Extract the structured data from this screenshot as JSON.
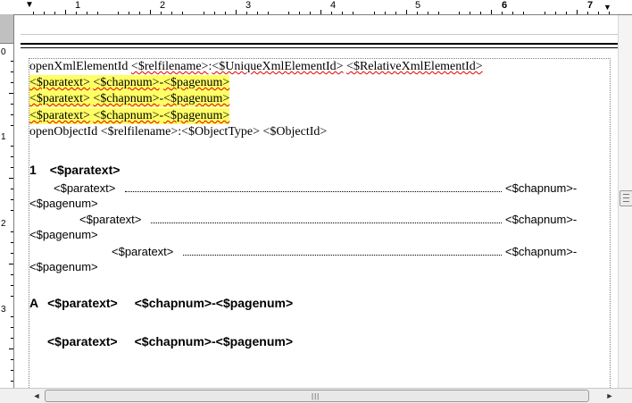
{
  "ruler": {
    "numbers": [
      "1",
      "2",
      "3",
      "4",
      "5",
      "6",
      "7"
    ],
    "left_numbers": [
      "0",
      "1",
      "2",
      "3"
    ],
    "tab_marker": "▼",
    "right_marker": "▼"
  },
  "document": {
    "line1": {
      "prefix": "openXmlElementId ",
      "relfile": "<$relfilename>",
      "sep": ":",
      "unique": "<$UniqueXmlElementId>",
      "space": " ",
      "relative": "<$RelativeXmlElementId>"
    },
    "highlight_lines": [
      {
        "paratext": "<$paratext>",
        "chapnum": "<$chapnum>",
        "dash": "-",
        "pagenum": "<$pagenum>"
      },
      {
        "paratext": "<$paratext>",
        "chapnum": "<$chapnum>",
        "dash": "-",
        "pagenum": "<$pagenum>"
      },
      {
        "paratext": "<$paratext>",
        "chapnum": "<$chapnum>",
        "dash": "-",
        "pagenum": "<$pagenum>"
      }
    ],
    "object_line": "openObjectId <$relfilename>:<$ObjectType> <$ObjectId>",
    "heading1": {
      "num": "1",
      "text": "<$paratext>"
    },
    "toc_entries": [
      {
        "label": "<$paratext>",
        "right": "<$chapnum>-",
        "wrap": "<$pagenum>"
      },
      {
        "label": "<$paratext>",
        "right": "<$chapnum>-",
        "wrap": "<$pagenum>"
      },
      {
        "label": "<$paratext>",
        "right": "<$chapnum>-",
        "wrap": "<$pagenum>"
      }
    ],
    "headingA": {
      "letter": "A",
      "text": "<$paratext>",
      "ref": "<$chapnum>-<$pagenum>"
    },
    "headingB": {
      "text": "<$paratext>",
      "ref": "<$chapnum>-<$pagenum>"
    }
  },
  "scrollbars": {
    "left_arrow": "◄",
    "right_arrow": "►",
    "grip": "|||"
  },
  "colors": {
    "highlight": "#ffff66",
    "spell_error": "#e00000"
  }
}
